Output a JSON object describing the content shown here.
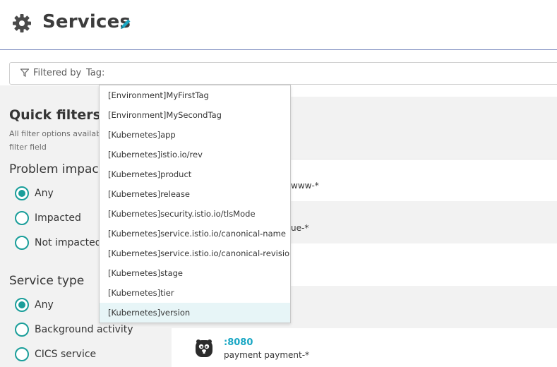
{
  "header": {
    "title": "Services",
    "icon": "gear-icon",
    "edit_icon": "pencil-icon"
  },
  "filter": {
    "label": "Filtered by",
    "value": "Tag:",
    "icon": "funnel-icon"
  },
  "dropdown": {
    "items": [
      "[Environment]MyFirstTag",
      "[Environment]MySecondTag",
      "[Kubernetes]app",
      "[Kubernetes]istio.io/rev",
      "[Kubernetes]product",
      "[Kubernetes]release",
      "[Kubernetes]security.istio.io/tlsMode",
      "[Kubernetes]service.istio.io/canonical-name",
      "[Kubernetes]service.istio.io/canonical-revision",
      "[Kubernetes]stage",
      "[Kubernetes]tier",
      "[Kubernetes]version"
    ],
    "highlighted_index": 11
  },
  "sidebar": {
    "quick_filters_title": "Quick filters",
    "quick_filters_desc_line1": "All filter options availab",
    "quick_filters_desc_line2": "filter field",
    "problem_impact": {
      "title": "Problem impact",
      "options": [
        "Any",
        "Impacted",
        "Not impacted"
      ],
      "selected": "Any"
    },
    "service_type": {
      "title": "Service type",
      "options": [
        "Any",
        "Background activity",
        "CICS service"
      ],
      "selected": "Any"
    }
  },
  "main": {
    "partial_rows": [
      "www-*",
      "ue-*"
    ],
    "service": {
      "port": ":8080",
      "name": "payment payment-*"
    }
  },
  "colors": {
    "accent": "#1a9e9a",
    "link": "#1aa7c4",
    "header_border": "#6f7fb8",
    "sidebar_bg": "#f2f2f2",
    "hover_bg": "#e7f5f7"
  }
}
